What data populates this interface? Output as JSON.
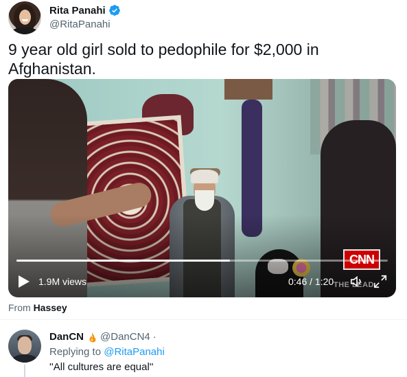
{
  "tweet": {
    "author": {
      "display_name": "Rita Panahi",
      "handle": "@RitaPanahi",
      "verified": true
    },
    "text": "9 year old girl sold to pedophile for $2,000 in Afghanistan.",
    "video": {
      "views": "1.9M views",
      "time": "0:46 / 1:20",
      "progress": 0.575,
      "watermark_logo": "CNN",
      "watermark_show": "THE LEAD",
      "icons": {
        "play": "play-icon",
        "volume": "volume-icon",
        "fullscreen": "fullscreen-icon"
      }
    },
    "from_prefix": "From",
    "from_source": "Hassey"
  },
  "reply": {
    "display_name": "DanCN",
    "emoji_icon": "fire-emoji-icon",
    "handle": "@DanCN4",
    "separator": "·",
    "replying_prefix": "Replying to",
    "replying_to": "@RitaPanahi",
    "text": "''All cultures are equal''"
  },
  "colors": {
    "primary_text": "#0f1419",
    "secondary_text": "#536471",
    "link": "#1d9bf0",
    "verified_blue": "#1d9bf0",
    "cnn_red": "#cc0000"
  }
}
